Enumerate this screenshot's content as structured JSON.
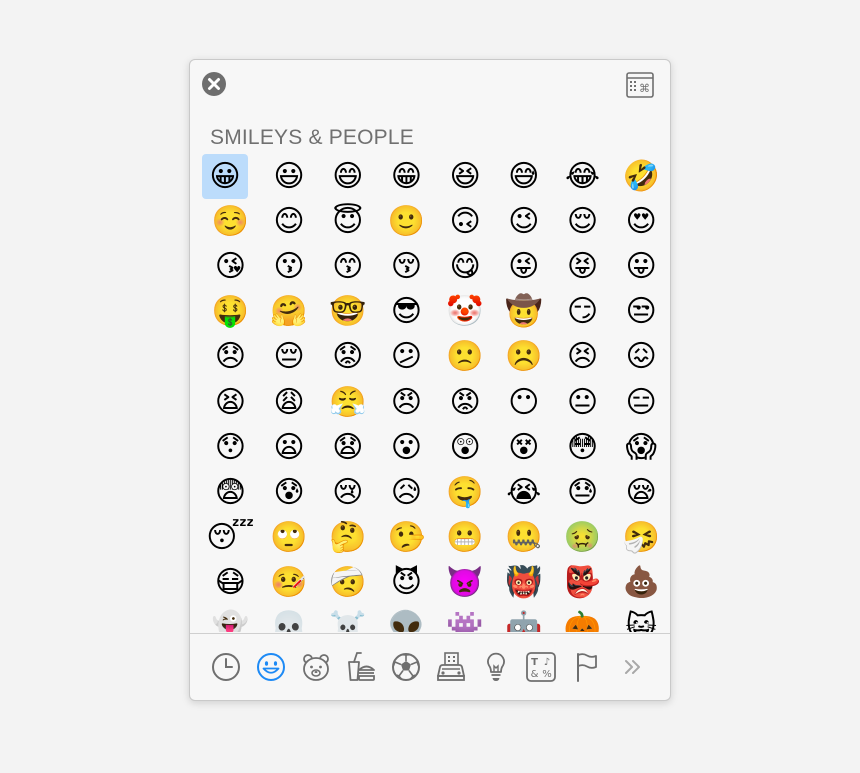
{
  "window": {
    "close_icon": "close-icon",
    "char_viewer_icon": "character-viewer-icon"
  },
  "section": {
    "title": "SMILEYS & PEOPLE"
  },
  "emojis": [
    "😀",
    "😃",
    "😄",
    "😁",
    "😆",
    "😅",
    "😂",
    "🤣",
    "☺️",
    "😊",
    "😇",
    "🙂",
    "🙃",
    "😉",
    "😌",
    "😍",
    "😘",
    "😗",
    "😙",
    "😚",
    "😋",
    "😜",
    "😝",
    "😛",
    "🤑",
    "🤗",
    "🤓",
    "😎",
    "🤡",
    "🤠",
    "😏",
    "😒",
    "😞",
    "😔",
    "😟",
    "😕",
    "🙁",
    "☹️",
    "😣",
    "😖",
    "😫",
    "😩",
    "😤",
    "😠",
    "😡",
    "😶",
    "😐",
    "😑",
    "😯",
    "😦",
    "😧",
    "😮",
    "😲",
    "😵",
    "😳",
    "😱",
    "😨",
    "😰",
    "😢",
    "😥",
    "🤤",
    "😭",
    "😓",
    "😪",
    "😴",
    "🙄",
    "🤔",
    "🤥",
    "😬",
    "🤐",
    "🤢",
    "🤧",
    "😷",
    "🤒",
    "🤕",
    "😈",
    "👿",
    "👹",
    "👺",
    "💩",
    "👻",
    "💀",
    "☠️",
    "👽",
    "👾",
    "🤖",
    "🎃",
    "😺"
  ],
  "selected_emoji": "😀",
  "tabs": [
    {
      "name": "recent",
      "icon": "clock-icon"
    },
    {
      "name": "smileys",
      "icon": "smiley-icon",
      "active": true
    },
    {
      "name": "animals",
      "icon": "bear-icon"
    },
    {
      "name": "food",
      "icon": "food-drink-icon"
    },
    {
      "name": "activity",
      "icon": "soccer-ball-icon"
    },
    {
      "name": "travel",
      "icon": "travel-places-icon"
    },
    {
      "name": "objects",
      "icon": "lightbulb-icon"
    },
    {
      "name": "symbols",
      "icon": "symbols-icon"
    },
    {
      "name": "flags",
      "icon": "flag-icon"
    },
    {
      "name": "more",
      "icon": "chevron-right-double-icon"
    }
  ],
  "colors": {
    "active_tab": "#1d8af5",
    "inactive_tab": "#6f6f6f",
    "selection": "#bcdcfb"
  }
}
